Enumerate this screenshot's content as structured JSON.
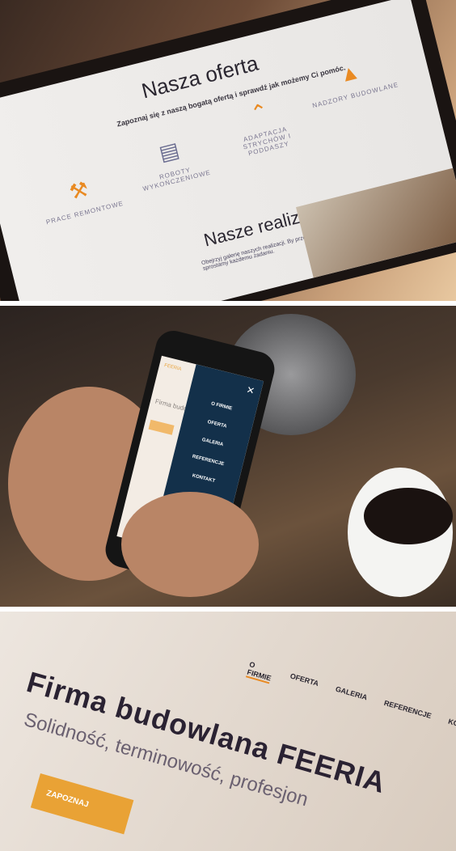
{
  "laptop_site": {
    "title": "Nasza oferta",
    "subtitle": "Zapoznaj się z naszą bogatą ofertą i sprawdź jak możemy Ci pomóc.",
    "services": [
      {
        "label": "PRACE REMONTOWE",
        "icon": "drill-icon"
      },
      {
        "label": "ROBOTY WYKOŃCZENIOWE",
        "icon": "paint-roller-icon"
      },
      {
        "label": "ADAPTACJA STRYCHÓW I PODDASZY",
        "icon": "roof-icon"
      },
      {
        "label": "NADZORY BUDOWLANE",
        "icon": "hard-hat-icon"
      }
    ],
    "section2_title": "Nasze realizacje",
    "section2_subtitle": "Obejrzyj galerię naszych realizacji. By przekonać się, że sprostamy każdemu zadaniu.",
    "accent": "#e98a22"
  },
  "phone_site": {
    "logo": "FEERIA",
    "hero_title": "Firma budo",
    "menu": [
      "O FIRMIE",
      "OFERTA",
      "GALERIA",
      "REFERENCJE",
      "KONTAKT"
    ],
    "menu_bg": "#13304a"
  },
  "desktop_site": {
    "nav": [
      "O FIRMIE",
      "OFERTA",
      "GALERIA",
      "REFERENCJE",
      "KONTAKT"
    ],
    "title": "Firma budowlana FEERIA",
    "subtitle": "Solidność, terminowość, profesjon",
    "cta": "ZAPOZNAJ"
  }
}
